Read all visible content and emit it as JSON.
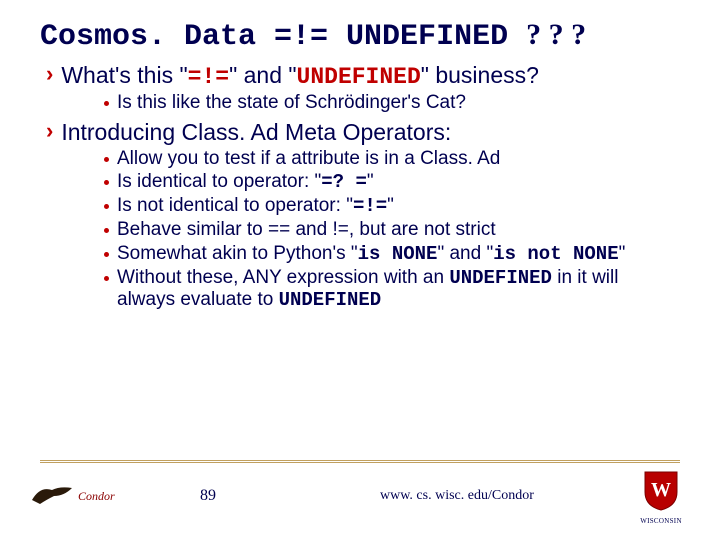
{
  "title": {
    "code": "Cosmos. Data =!= UNDEFINED",
    "qmarks": "? ? ?"
  },
  "bullets": [
    {
      "pre": "What's this \"",
      "op": "=!=",
      "mid": "\" and \"",
      "kw": "UNDEFINED",
      "post": "\" business?",
      "sub": [
        {
          "text": "Is this like the state of Schrödinger's Cat?"
        }
      ]
    },
    {
      "text": "Introducing Class. Ad Meta Operators:",
      "sub": [
        {
          "text": "Allow you to test if a attribute is in a Class. Ad"
        },
        {
          "pre": "Is identical to operator: \"",
          "mono": "=? =",
          "post": "\""
        },
        {
          "pre": "Is not identical to operator: \"",
          "mono": "=!=",
          "post": "\""
        },
        {
          "text": "Behave similar to == and !=, but are not strict"
        },
        {
          "pre": "Somewhat akin to Python's \"",
          "mono1": "is NONE",
          "mid": "\" and \"",
          "mono2": "is not NONE",
          "post": "\""
        },
        {
          "pre": "Without these, ANY expression with an ",
          "mono1": "UNDEFINED",
          "mid": " in it will always evaluate to ",
          "mono2": "UNDEFINED",
          "post": ""
        }
      ]
    }
  ],
  "footer": {
    "page": "89",
    "url": "www. cs. wisc. edu/Condor",
    "logo_left": "Condor",
    "logo_right": "WISCONSIN"
  }
}
